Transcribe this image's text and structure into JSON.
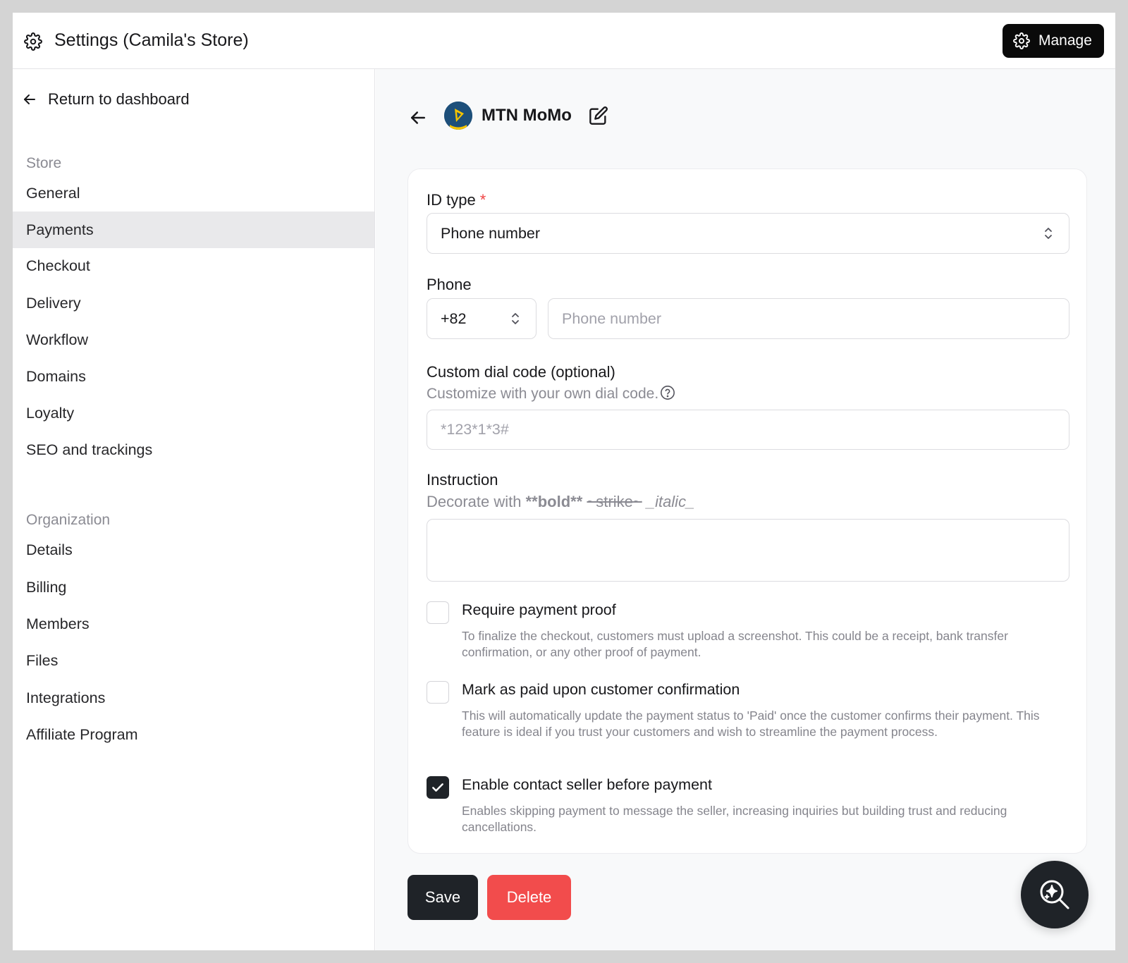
{
  "header": {
    "title": "Settings (Camila's Store)",
    "manage_label": "Manage",
    "gear_icon": "gear-icon"
  },
  "sidebar": {
    "return_label": "Return to dashboard",
    "store_section": "Store",
    "store_items": [
      {
        "label": "General"
      },
      {
        "label": "Payments",
        "active": true
      },
      {
        "label": "Checkout"
      },
      {
        "label": "Delivery"
      },
      {
        "label": "Workflow"
      },
      {
        "label": "Domains"
      },
      {
        "label": "Loyalty"
      },
      {
        "label": "SEO and trackings"
      }
    ],
    "org_section": "Organization",
    "org_items": [
      {
        "label": "Details"
      },
      {
        "label": "Billing"
      },
      {
        "label": "Members"
      },
      {
        "label": "Files"
      },
      {
        "label": "Integrations"
      },
      {
        "label": "Affiliate Program"
      }
    ]
  },
  "main": {
    "provider_name": "MTN MoMo",
    "id_type": {
      "label": "ID type",
      "required_mark": "*",
      "value": "Phone number"
    },
    "phone": {
      "label": "Phone",
      "country_code": "+82",
      "placeholder": "Phone number"
    },
    "dial_code": {
      "label": "Custom dial code (optional)",
      "hint": "Customize with your own dial code.",
      "placeholder": "*123*1*3#"
    },
    "instruction": {
      "label": "Instruction",
      "hint_prefix": "Decorate with ",
      "hint_bold": "**bold**",
      "hint_strike": "~strike~",
      "hint_italic": "_italic_",
      "value": ""
    },
    "options": [
      {
        "label": "Require payment proof",
        "description": "To finalize the checkout, customers must upload a screenshot. This could be a receipt, bank transfer confirmation, or any other proof of payment.",
        "checked": false
      },
      {
        "label": "Mark as paid upon customer confirmation",
        "description": "This will automatically update the payment status to 'Paid' once the customer confirms their payment. This feature is ideal if you trust your customers and wish to streamline the payment process.",
        "checked": false
      },
      {
        "label": "Enable contact seller before payment",
        "description": "Enables skipping payment to message the seller, increasing inquiries but building trust and reducing cancellations.",
        "checked": true
      }
    ],
    "save_label": "Save",
    "delete_label": "Delete"
  },
  "colors": {
    "primary_dark": "#1f2328",
    "danger": "#f24c4c",
    "active_nav_bg": "#e9e9eb",
    "required": "#ef4444"
  }
}
